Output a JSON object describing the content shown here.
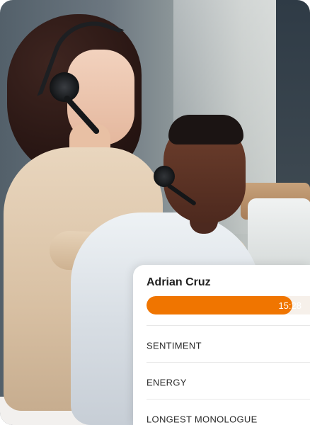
{
  "card": {
    "name": "Adrian Cruz",
    "duration": "15:28",
    "progress": 0.89,
    "accent": "#f07500",
    "metrics": [
      {
        "label": "SENTIMENT"
      },
      {
        "label": "ENERGY"
      },
      {
        "label": "LONGEST MONOLOGUE"
      }
    ]
  }
}
